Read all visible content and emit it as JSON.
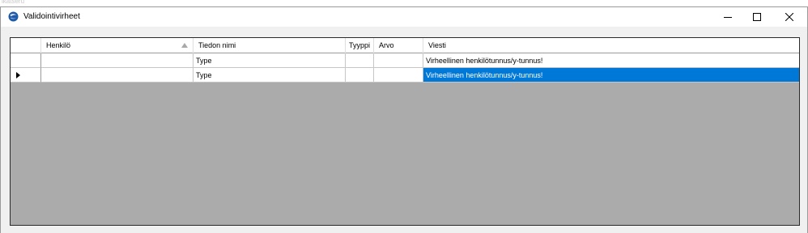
{
  "background_fragment": "ikatseru",
  "window": {
    "title": "Validointivirheet",
    "icon": "app-globe-icon"
  },
  "titlebar_buttons": [
    "minimize-icon",
    "maximize-icon",
    "close-icon"
  ],
  "grid": {
    "columns": [
      "Henkilö",
      "Tiedon nimi",
      "Tyyppi",
      "Arvo",
      "Viesti"
    ],
    "sorted_column": "Henkilö",
    "sort_direction": "ascending",
    "rows": [
      {
        "henkilo": "",
        "tiedon_nimi": "Type",
        "tyyppi": "",
        "arvo": "",
        "viesti": "Virheellinen henkilötunnus/y-tunnus!"
      },
      {
        "henkilo": "",
        "tiedon_nimi": "Type",
        "tyyppi": "",
        "arvo": "",
        "viesti": "Virheellinen henkilötunnus/y-tunnus!"
      }
    ],
    "current_row": 1,
    "selected_cell": "viesti"
  },
  "colors": {
    "selection": "#0078d7",
    "empty_area": "#ababab",
    "window_bg": "#f0f0f0"
  }
}
